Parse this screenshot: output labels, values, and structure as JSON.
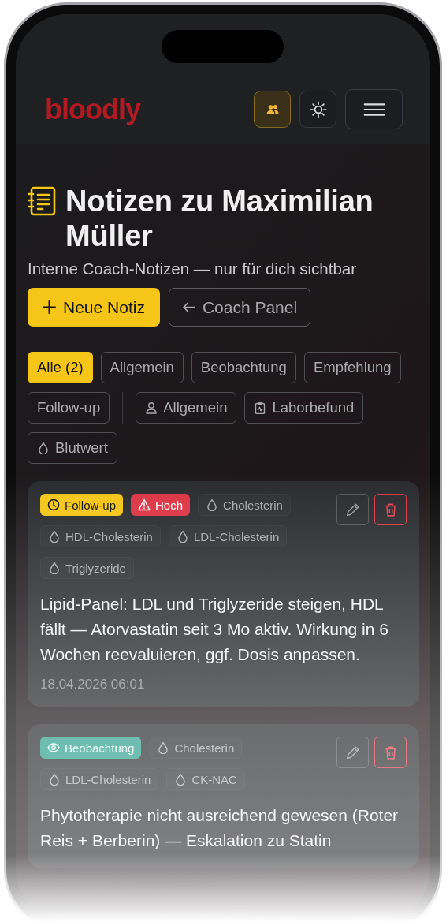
{
  "header": {
    "logo": "bloodly",
    "buttons": [
      {
        "kind": "coach",
        "selected": true
      },
      {
        "kind": "theme",
        "selected": false
      },
      {
        "kind": "menu",
        "selected": false
      }
    ]
  },
  "title": "Notizen zu Maximilian Müller",
  "subtitle": "Interne Coach-Notizen — nur für dich sichtbar",
  "actions": [
    {
      "kind": "primary",
      "label": "Neue Notiz"
    },
    {
      "kind": "back",
      "label": "Coach Panel"
    }
  ],
  "filters": [
    {
      "kind": "type",
      "label": "Alle (2)",
      "selected": true
    },
    {
      "kind": "type",
      "label": "Allgemein",
      "selected": false
    },
    {
      "kind": "type",
      "label": "Beobachtung",
      "selected": false
    },
    {
      "kind": "type",
      "label": "Empfehlung",
      "selected": false
    },
    {
      "kind": "type",
      "label": "Follow-up",
      "selected": false
    },
    {
      "kind": "person",
      "label": "Allgemein",
      "selected": false
    },
    {
      "kind": "lab",
      "label": "Laborbefund",
      "selected": false
    },
    {
      "kind": "blood",
      "label": "Blutwert",
      "selected": false
    }
  ],
  "notes": [
    {
      "tags": [
        {
          "kind": "followup",
          "label": "Follow-up"
        },
        {
          "kind": "priority",
          "label": "Hoch"
        },
        {
          "kind": "marker",
          "label": "Cholesterin"
        },
        {
          "kind": "marker",
          "label": "HDL-Cholesterin"
        },
        {
          "kind": "marker",
          "label": "LDL-Cholesterin"
        },
        {
          "kind": "marker",
          "label": "Triglyzeride"
        }
      ],
      "text": "Lipid-Panel: LDL und Triglyzeride steigen, HDL fällt — Atorvastatin seit 3 Mo aktiv. Wirkung in 6 Wochen reevaluieren, ggf. Dosis anpassen.",
      "date": "18.04.2026 06:01"
    },
    {
      "tags": [
        {
          "kind": "observation",
          "label": "Beobachtung"
        },
        {
          "kind": "marker",
          "label": "Cholesterin"
        },
        {
          "kind": "marker",
          "label": "LDL-Cholesterin"
        },
        {
          "kind": "marker",
          "label": "CK-NAC"
        }
      ],
      "text": "Phytotherapie nicht ausreichend gewesen (Roter Reis + Berberin) — Eskalation zu Statin"
    }
  ]
}
